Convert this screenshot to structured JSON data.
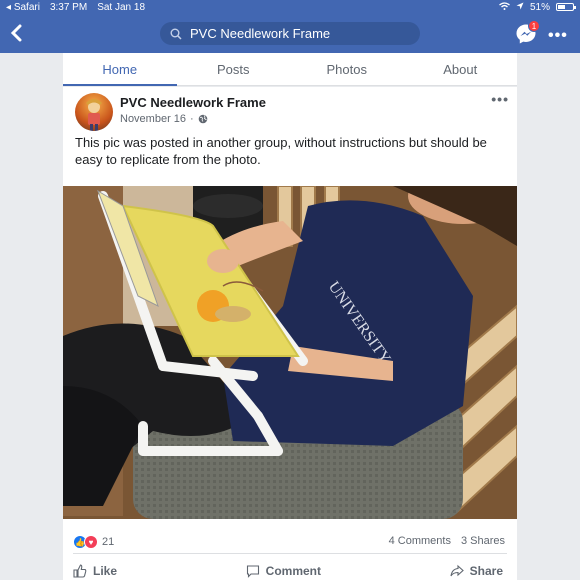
{
  "status_bar": {
    "app": "Safari",
    "time": "3:37 PM",
    "date": "Sat Jan 18",
    "battery": "51%"
  },
  "nav": {
    "search_value": "PVC Needlework Frame",
    "messenger_badge": "1"
  },
  "tabs": [
    {
      "label": "Home",
      "active": true
    },
    {
      "label": "Posts",
      "active": false
    },
    {
      "label": "Photos",
      "active": false
    },
    {
      "label": "About",
      "active": false
    }
  ],
  "post": {
    "author": "PVC Needlework Frame",
    "date": "November 16",
    "visibility_sep": "·",
    "text": "This pic was posted in another group, without instructions but should be easy to replicate from the photo.",
    "reaction_count": "21",
    "comments": "4 Comments",
    "shares": "3 Shares"
  },
  "actions": {
    "like": "Like",
    "comment": "Comment",
    "share": "Share"
  },
  "colors": {
    "facebook_blue": "#4267b2",
    "search_bg": "#365899",
    "badge_red": "#fa3e3e"
  }
}
